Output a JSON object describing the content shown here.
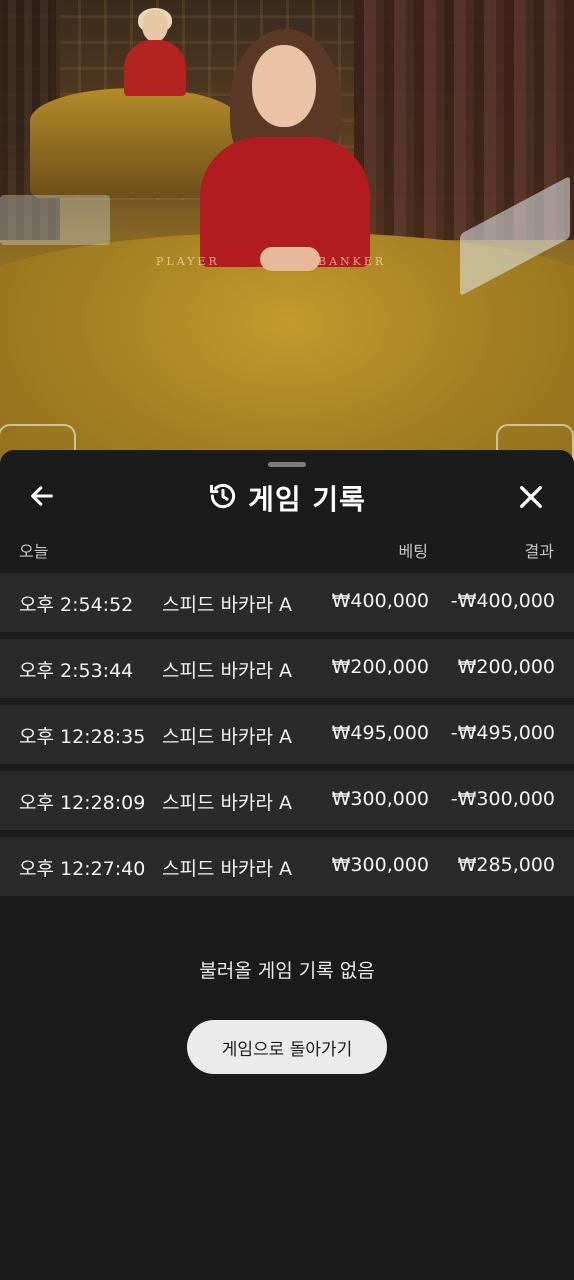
{
  "stream": {
    "player_label": "PLAYER",
    "banker_label": "BANKER"
  },
  "header": {
    "title": "게임 기록",
    "back_icon": "arrow-left-icon",
    "history_icon": "history-icon",
    "close_icon": "close-icon"
  },
  "columns": {
    "date": "오늘",
    "bet": "베팅",
    "result": "결과"
  },
  "rows": [
    {
      "time": "오후 2:54:52",
      "game": "스피드 바카라 A",
      "bet": "₩400,000",
      "result": "-₩400,000"
    },
    {
      "time": "오후 2:53:44",
      "game": "스피드 바카라 A",
      "bet": "₩200,000",
      "result": "₩200,000"
    },
    {
      "time": "오후 12:28:35",
      "game": "스피드 바카라 A",
      "bet": "₩495,000",
      "result": "-₩495,000"
    },
    {
      "time": "오후 12:28:09",
      "game": "스피드 바카라 A",
      "bet": "₩300,000",
      "result": "-₩300,000"
    },
    {
      "time": "오후 12:27:40",
      "game": "스피드 바카라 A",
      "bet": "₩300,000",
      "result": "₩285,000"
    }
  ],
  "empty_message": "불러올 게임 기록 없음",
  "return_button": "게임으로 돌아가기",
  "colors": {
    "sheet_bg": "#1b1b1b",
    "row_bg": "#2a2a2a",
    "button_bg": "#ebebeb"
  }
}
